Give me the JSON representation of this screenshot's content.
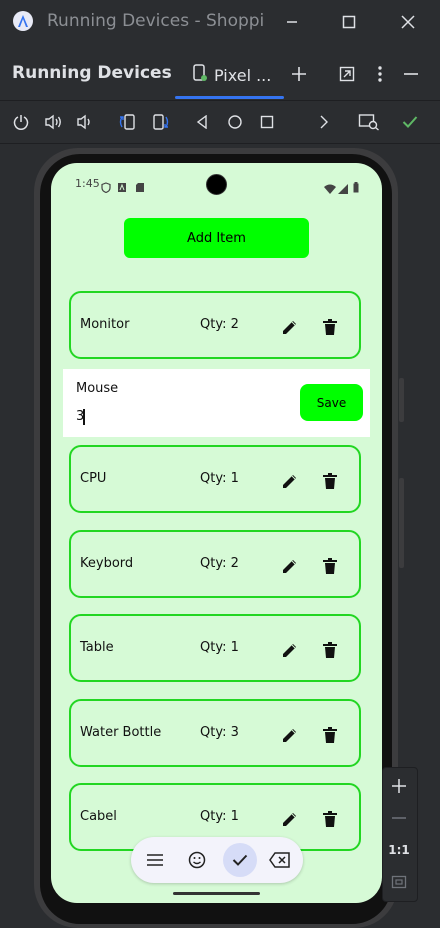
{
  "window": {
    "title": "Running Devices - Shopping",
    "icons": [
      "android-studio-logo-icon",
      "minimize-icon",
      "maximize-icon",
      "close-icon"
    ]
  },
  "tool_window": {
    "title": "Running Devices",
    "device_tab": "Pixel ...",
    "header_icons": [
      "add-icon",
      "float-window-icon",
      "more-options-icon",
      "hide-icon"
    ]
  },
  "toolbar": {
    "icons": [
      "power-icon",
      "volume-up-icon",
      "volume-down-icon",
      "rotate-left-icon",
      "rotate-right-icon",
      "back-icon",
      "home-icon",
      "overview-icon",
      "forward-icon",
      "screenshot-icon",
      "check-icon"
    ]
  },
  "device": {
    "status_time": "1:45",
    "add_button": "Add Item",
    "items_top": [
      {
        "name": "Monitor",
        "qty": "Qty: 2"
      }
    ],
    "editing": {
      "name": "Mouse",
      "qty_value": "3",
      "save_label": "Save"
    },
    "items_bottom": [
      {
        "name": "CPU",
        "qty": "Qty: 1"
      },
      {
        "name": "Keybord",
        "qty": "Qty: 2"
      },
      {
        "name": "Table",
        "qty": "Qty: 1"
      },
      {
        "name": "Water Bottle",
        "qty": "Qty: 3"
      },
      {
        "name": "Cabel",
        "qty": "Qty: 1"
      }
    ]
  },
  "zoom": {
    "ratio": "1:1"
  },
  "colors": {
    "accent": "#3574f0",
    "screen_bg": "#d6fad6",
    "button_green": "#00ff00",
    "card_border": "#22d622"
  }
}
